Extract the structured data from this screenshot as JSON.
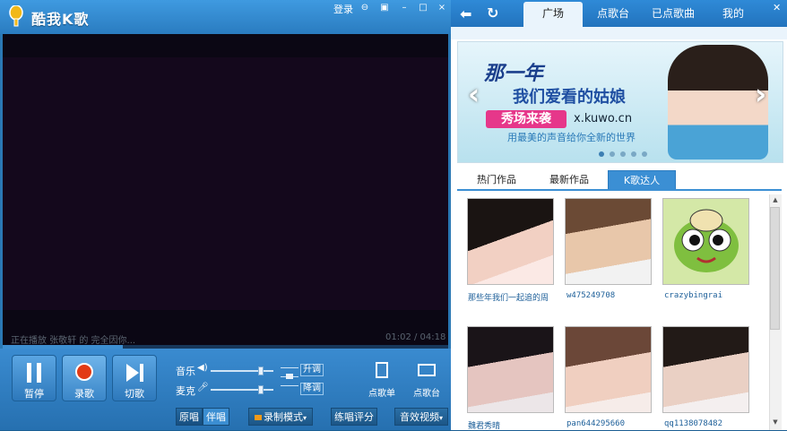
{
  "player": {
    "title": "酷我K歌",
    "login": "登录",
    "now_playing": "正在播放 张敬轩 的 完全因你...",
    "time": "01:02 / 04:18",
    "progress": 0.27,
    "buttons": {
      "pause": "暂停",
      "record": "录歌",
      "skip": "切歌"
    },
    "mixer": {
      "music_label": "音乐",
      "mic_label": "麦克",
      "music_level": 0.85,
      "mic_level": 0.85,
      "key_up": "升调",
      "key_down": "降调"
    },
    "tools": {
      "playlist": "点歌单",
      "jukebox": "点歌台"
    },
    "bottom": {
      "original": "原唱",
      "accompany": "伴唱",
      "record_mode": "录制模式",
      "practice_score": "练唱评分",
      "effect_video": "音效视频"
    }
  },
  "panel": {
    "tabs": [
      "广场",
      "点歌台",
      "已点歌曲",
      "我的"
    ],
    "active_tab": 0,
    "banner": {
      "line1": "那一年",
      "line2": "我们爱看的姑娘",
      "badge": "秀场来袭",
      "url": "x.kuwo.cn",
      "slogan": "用最美的声音给你全新的世界",
      "dots": 5,
      "active_dot": 0
    },
    "subtabs": [
      "热门作品",
      "最新作品",
      "K歌达人"
    ],
    "active_subtab": 2,
    "users": [
      {
        "name": "那些年我们一起追的周",
        "avatar": "girl-photo"
      },
      {
        "name": "w475249708",
        "avatar": "boy-photo"
      },
      {
        "name": "crazybingrai",
        "avatar": "frog-cartoon"
      },
      {
        "name": "魏君秀晴",
        "avatar": "girl-photo"
      },
      {
        "name": "pan644295660",
        "avatar": "girl-photo"
      },
      {
        "name": "qq1138078482",
        "avatar": "girl-photo"
      }
    ]
  }
}
